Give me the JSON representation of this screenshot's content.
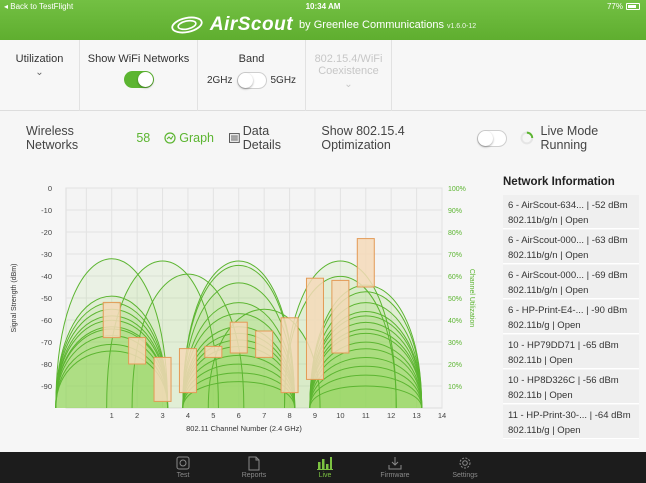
{
  "status": {
    "back": "◂ Back to TestFlight",
    "time": "10:34 AM",
    "battery": "77%"
  },
  "brand": {
    "name": "AirScout",
    "by": "by Greenlee Communications",
    "version": "v1.6.0-12"
  },
  "controls": {
    "utilization": "Utilization",
    "show_wifi": "Show WiFi Networks",
    "band": "Band",
    "band_2g": "2GHz",
    "band_5g": "5GHz",
    "coexist_line1": "802.15.4/WiFi",
    "coexist_line2": "Coexistence"
  },
  "info": {
    "wireless_label": "Wireless Networks",
    "wireless_count": "58",
    "graph": "Graph",
    "data_details": "Data Details",
    "show_optimization": "Show 802.15.4 Optimization",
    "live_mode": "Live Mode Running"
  },
  "colors": {
    "accent": "#5cb531",
    "bar_fill": "#f5d9b8",
    "bar_stroke": "#e39a55",
    "util_fill": "#8fd45a"
  },
  "chart_data": {
    "type": "area",
    "xlabel": "802.11 Channel Number (2.4 GHz)",
    "ylabel": "Signal Strength (dBm)",
    "y2label": "Channel Utilization",
    "x_ticks": [
      1,
      2,
      3,
      4,
      5,
      6,
      7,
      8,
      9,
      10,
      11,
      12,
      13,
      14
    ],
    "y_ticks": [
      0,
      -10,
      -20,
      -30,
      -40,
      -50,
      -60,
      -70,
      -80,
      -90
    ],
    "y2_ticks": [
      "100%",
      "90%",
      "80%",
      "70%",
      "60%",
      "50%",
      "40%",
      "30%",
      "20%",
      "10%"
    ],
    "ylim": [
      -100,
      0
    ],
    "xlim": [
      -0.8,
      14
    ],
    "utilization_bars": [
      {
        "channel": 1,
        "top": -52,
        "bottom": -68
      },
      {
        "channel": 2,
        "top": -68,
        "bottom": -80
      },
      {
        "channel": 3,
        "top": -77,
        "bottom": -97
      },
      {
        "channel": 4,
        "top": -73,
        "bottom": -93
      },
      {
        "channel": 5,
        "top": -72,
        "bottom": -77
      },
      {
        "channel": 6,
        "top": -61,
        "bottom": -75
      },
      {
        "channel": 7,
        "top": -65,
        "bottom": -77
      },
      {
        "channel": 8,
        "top": -59,
        "bottom": -93
      },
      {
        "channel": 9,
        "top": -41,
        "bottom": -87
      },
      {
        "channel": 10,
        "top": -42,
        "bottom": -75
      },
      {
        "channel": 11,
        "top": -23,
        "bottom": -45
      }
    ],
    "networks": [
      {
        "channel": 1,
        "dbm": -32
      },
      {
        "channel": 1,
        "dbm": -49
      },
      {
        "channel": 1,
        "dbm": -52
      },
      {
        "channel": 1,
        "dbm": -55
      },
      {
        "channel": 1,
        "dbm": -58
      },
      {
        "channel": 1,
        "dbm": -60
      },
      {
        "channel": 1,
        "dbm": -63
      },
      {
        "channel": 1,
        "dbm": -64
      },
      {
        "channel": 1,
        "dbm": -67
      },
      {
        "channel": 1,
        "dbm": -71
      },
      {
        "channel": 1,
        "dbm": -74
      },
      {
        "channel": 3,
        "dbm": -33
      },
      {
        "channel": 4,
        "dbm": -39
      },
      {
        "channel": 6,
        "dbm": -33
      },
      {
        "channel": 6,
        "dbm": -35
      },
      {
        "channel": 6,
        "dbm": -43
      },
      {
        "channel": 6,
        "dbm": -52
      },
      {
        "channel": 6,
        "dbm": -57
      },
      {
        "channel": 6,
        "dbm": -63
      },
      {
        "channel": 6,
        "dbm": -66
      },
      {
        "channel": 6,
        "dbm": -69
      },
      {
        "channel": 6,
        "dbm": -72
      },
      {
        "channel": 6,
        "dbm": -76
      },
      {
        "channel": 6,
        "dbm": -80
      },
      {
        "channel": 6,
        "dbm": -84
      },
      {
        "channel": 6,
        "dbm": -88
      },
      {
        "channel": 7,
        "dbm": -55
      },
      {
        "channel": 10,
        "dbm": -33
      },
      {
        "channel": 10,
        "dbm": -40
      },
      {
        "channel": 11,
        "dbm": -44
      },
      {
        "channel": 11,
        "dbm": -47
      },
      {
        "channel": 11,
        "dbm": -52
      },
      {
        "channel": 11,
        "dbm": -56
      },
      {
        "channel": 11,
        "dbm": -58
      },
      {
        "channel": 11,
        "dbm": -61
      },
      {
        "channel": 11,
        "dbm": -64
      },
      {
        "channel": 11,
        "dbm": -66
      },
      {
        "channel": 11,
        "dbm": -70
      },
      {
        "channel": 11,
        "dbm": -73
      },
      {
        "channel": 11,
        "dbm": -77
      },
      {
        "channel": 11,
        "dbm": -81
      },
      {
        "channel": 11,
        "dbm": -85
      },
      {
        "channel": 11,
        "dbm": -90
      }
    ]
  },
  "network_panel": {
    "title": "Network Information",
    "items": [
      {
        "line1": "6 - AirScout-634... | -52 dBm",
        "line2": "802.11b/g/n | Open"
      },
      {
        "line1": "6 - AirScout-000... | -63 dBm",
        "line2": "802.11b/g/n | Open"
      },
      {
        "line1": "6 - AirScout-000... | -69 dBm",
        "line2": "802.11b/g/n | Open"
      },
      {
        "line1": "6 - HP-Print-E4-... | -90 dBm",
        "line2": "802.11b/g | Open"
      },
      {
        "line1": "10 - HP79DD71 | -65 dBm",
        "line2": "802.11b | Open"
      },
      {
        "line1": "10 - HP8D326C | -56 dBm",
        "line2": "802.11b | Open"
      },
      {
        "line1": "11 - HP-Print-30-... | -64 dBm",
        "line2": "802.11b/g | Open"
      }
    ]
  },
  "tabs": [
    {
      "label": "Test",
      "icon": "test-icon"
    },
    {
      "label": "Reports",
      "icon": "document-icon"
    },
    {
      "label": "Live",
      "icon": "bar-chart-icon"
    },
    {
      "label": "Firmware",
      "icon": "download-icon"
    },
    {
      "label": "Settings",
      "icon": "gear-icon"
    }
  ]
}
